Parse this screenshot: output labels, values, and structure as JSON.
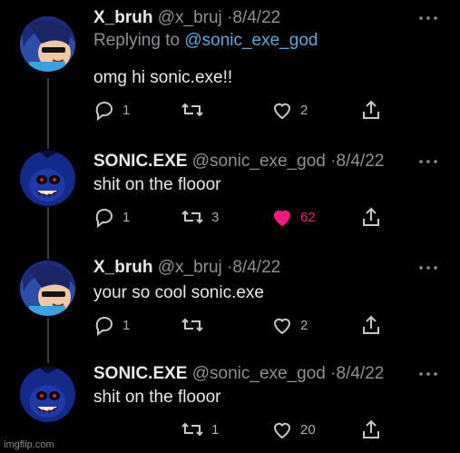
{
  "tweets": [
    {
      "name": "X_bruh",
      "handle": "@x_bruj",
      "separator": "·",
      "date": "8/4/22",
      "replying_prefix": "Replying to",
      "replying_handle": "@sonic_exe_god",
      "text": "omg hi sonic.exe!!",
      "reply_count": "1",
      "retweet_count": "",
      "like_count": "2",
      "liked": false
    },
    {
      "name": "SONIC.EXE",
      "handle": "@sonic_exe_god",
      "separator": "·",
      "date": "8/4/22",
      "text": "shit on the flooor",
      "reply_count": "1",
      "retweet_count": "3",
      "like_count": "62",
      "liked": true
    },
    {
      "name": "X_bruh",
      "handle": "@x_bruj",
      "separator": "·",
      "date": "8/4/22",
      "text": "your so cool sonic.exe",
      "reply_count": "1",
      "retweet_count": "",
      "like_count": "2",
      "liked": false
    },
    {
      "name": "SONIC.EXE",
      "handle": "@sonic_exe_god",
      "separator": "·",
      "date": "8/4/22",
      "text": "shit on the flooor",
      "reply_count": "",
      "retweet_count": "1",
      "like_count": "20",
      "liked": false
    }
  ],
  "icons": {
    "reply": "reply-icon",
    "retweet": "retweet-icon",
    "like": "heart-icon",
    "share": "share-icon",
    "more": "more-icon"
  },
  "colors": {
    "background": "#000000",
    "text": "#e7e9ea",
    "muted": "#8b9196",
    "link": "#5aa9e6",
    "like_active": "#f91880"
  },
  "watermark": "imgflip.com"
}
